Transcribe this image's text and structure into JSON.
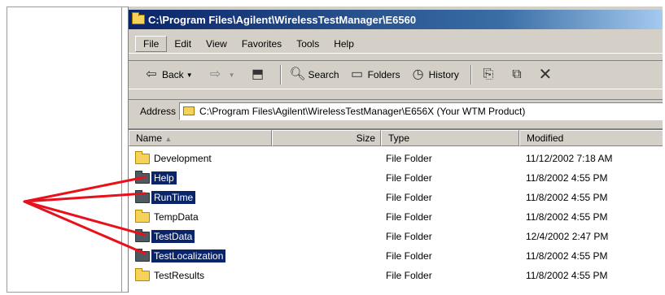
{
  "window": {
    "title": "C:\\Program Files\\Agilent\\WirelessTestManager\\E6560"
  },
  "menu": [
    "File",
    "Edit",
    "View",
    "Favorites",
    "Tools",
    "Help"
  ],
  "toolbar": {
    "back_label": "Back",
    "search_label": "Search",
    "folders_label": "Folders",
    "history_label": "History"
  },
  "address": {
    "label": "Address",
    "value": "C:\\Program Files\\Agilent\\WirelessTestManager\\E656X (Your WTM Product)"
  },
  "columns": {
    "name": "Name",
    "size": "Size",
    "type": "Type",
    "modified": "Modified"
  },
  "files": [
    {
      "name": "Development",
      "type": "File Folder",
      "modified": "11/12/2002 7:18 AM",
      "selected": false
    },
    {
      "name": "Help",
      "type": "File Folder",
      "modified": "11/8/2002 4:55 PM",
      "selected": true
    },
    {
      "name": "RunTime",
      "type": "File Folder",
      "modified": "11/8/2002 4:55 PM",
      "selected": true
    },
    {
      "name": "TempData",
      "type": "File Folder",
      "modified": "11/8/2002 4:55 PM",
      "selected": false
    },
    {
      "name": "TestData",
      "type": "File Folder",
      "modified": "12/4/2002 2:47 PM",
      "selected": true
    },
    {
      "name": "TestLocalization",
      "type": "File Folder",
      "modified": "11/8/2002 4:55 PM",
      "selected": true
    },
    {
      "name": "TestResults",
      "type": "File Folder",
      "modified": "11/8/2002 4:55 PM",
      "selected": false
    }
  ],
  "colors": {
    "selection": "#0a246a",
    "callout": "#e8101a",
    "window_face": "#d4d0c8"
  }
}
